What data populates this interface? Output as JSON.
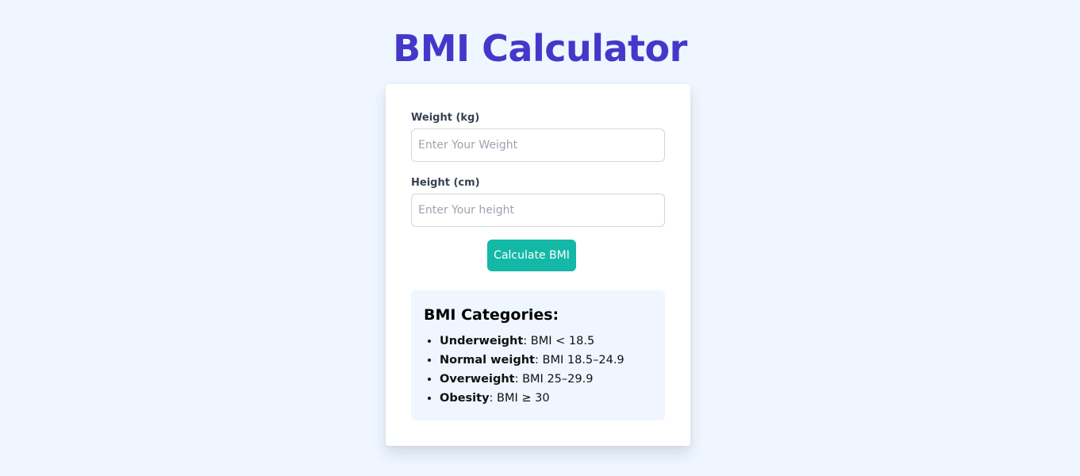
{
  "header": {
    "title": "BMI Calculator"
  },
  "form": {
    "weight": {
      "label": "Weight (kg)",
      "placeholder": "Enter Your Weight",
      "value": ""
    },
    "height": {
      "label": "Height (cm)",
      "placeholder": "Enter Your height",
      "value": ""
    },
    "calculate_label": "Calculate BMI"
  },
  "categories": {
    "title": "BMI Categories:",
    "items": [
      {
        "name": "Underweight",
        "range": ": BMI < 18.5"
      },
      {
        "name": "Normal weight",
        "range": ": BMI 18.5–24.9"
      },
      {
        "name": "Overweight",
        "range": ": BMI 25–29.9"
      },
      {
        "name": "Obesity",
        "range": ": BMI ≥ 30"
      }
    ]
  },
  "colors": {
    "page_background": "#eff6ff",
    "title": "#4338ca",
    "button": "#14b8a6",
    "categories_background": "#eff6ff"
  }
}
